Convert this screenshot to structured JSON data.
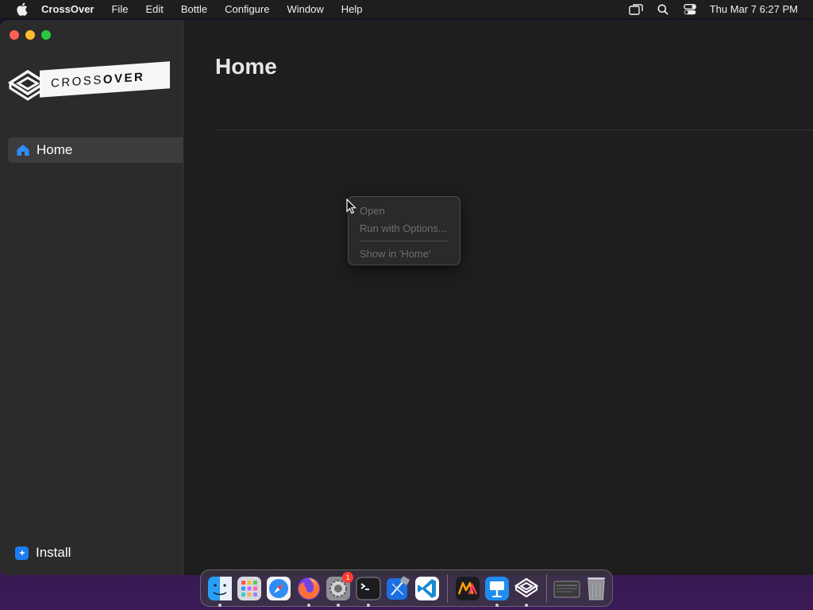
{
  "menubar": {
    "app_name": "CrossOver",
    "items": [
      "File",
      "Edit",
      "Bottle",
      "Configure",
      "Window",
      "Help"
    ],
    "clock": "Thu Mar 7  6:27 PM"
  },
  "sidebar": {
    "logo_text_light": "CROSS",
    "logo_text_bold": "OVER",
    "home_label": "Home",
    "install_label": "Install"
  },
  "main": {
    "title": "Home"
  },
  "context_menu": {
    "items": [
      "Open",
      "Run with Options...",
      "Show in 'Home'"
    ]
  },
  "dock": {
    "apps": [
      "finder-icon",
      "launchpad-icon",
      "safari-icon",
      "firefox-icon",
      "system-settings-icon",
      "terminal-icon",
      "xcode-icon",
      "vscode-icon",
      "mkeditor-icon",
      "keynote-icon",
      "crossover-icon",
      "screenshot-icon",
      "trash-icon"
    ],
    "settings_badge": "1"
  },
  "colors": {
    "accent": "#1c7df2",
    "close": "#fe5f57",
    "minimize": "#febc2e",
    "maximize": "#28c840"
  }
}
